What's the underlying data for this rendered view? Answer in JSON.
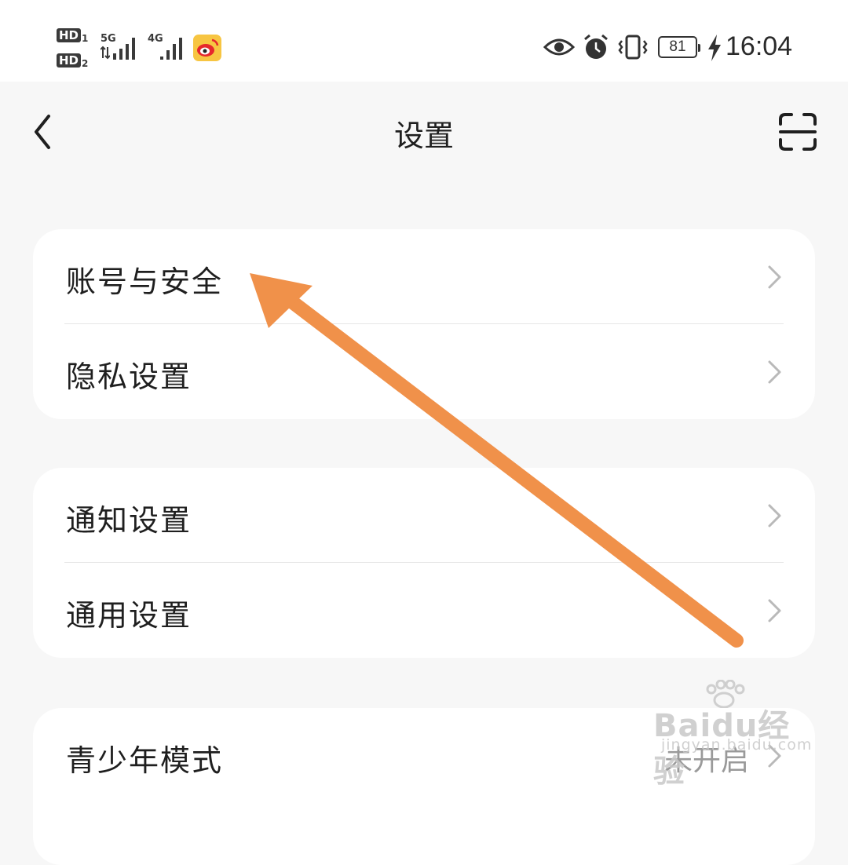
{
  "status_bar": {
    "sim1_badge": "HD",
    "sim1_index": "1",
    "sim2_badge": "HD",
    "sim2_index": "2",
    "net1_type": "5G",
    "net2_type": "4G",
    "battery_level": "81",
    "time": "16:04",
    "icons": [
      "hd-icon",
      "signal-icon",
      "weibo-app-icon",
      "eye-icon",
      "alarm-icon",
      "vibrate-icon",
      "battery-icon",
      "charging-icon"
    ]
  },
  "header": {
    "title": "设置",
    "back_icon": "chevron-left-icon",
    "scan_icon": "scan-icon"
  },
  "groups": [
    {
      "items": [
        {
          "label": "账号与安全"
        },
        {
          "label": "隐私设置"
        }
      ]
    },
    {
      "items": [
        {
          "label": "通知设置"
        },
        {
          "label": "通用设置"
        }
      ]
    },
    {
      "items": [
        {
          "label": "青少年模式",
          "value": "未开启"
        }
      ]
    }
  ],
  "watermark": {
    "brand": "Baidu经验",
    "domain": "jingyan.baidu.com"
  },
  "colors": {
    "annotation_arrow": "#f0914a",
    "background": "#f7f7f7",
    "card": "#ffffff",
    "weibo_icon_bg": "#f7c542"
  }
}
